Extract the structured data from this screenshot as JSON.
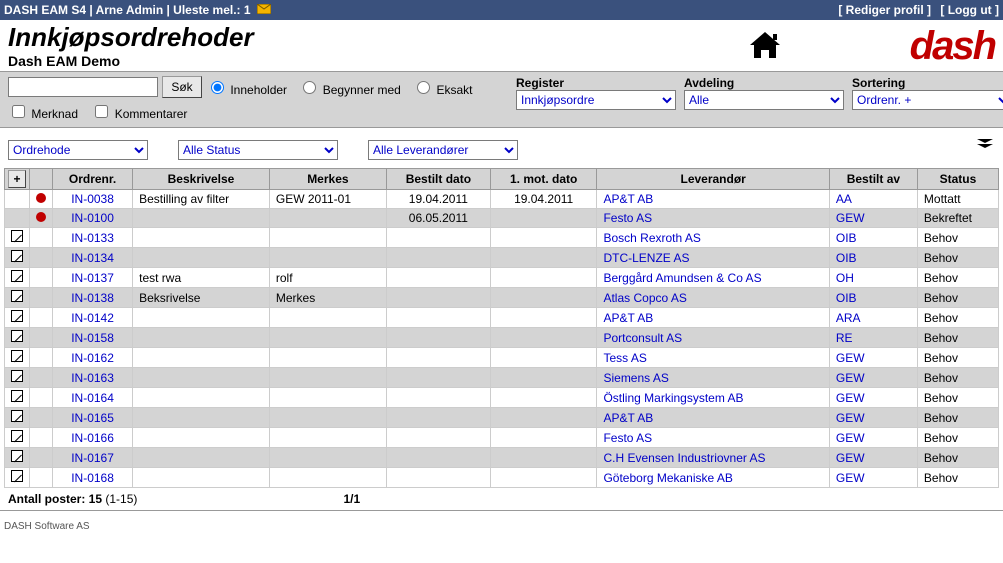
{
  "topbar": {
    "title": "DASH EAM S4 | Arne Admin | Uleste mel.: 1",
    "links": {
      "edit_profile": "[ Rediger profil ]",
      "logout": "[ Logg ut ]"
    }
  },
  "header": {
    "title": "Innkjøpsordrehoder",
    "subtitle": "Dash EAM Demo",
    "logo_text": "dash"
  },
  "search": {
    "search_btn": "Søk",
    "radio_inneholder": "Inneholder",
    "radio_begynner": "Begynner med",
    "radio_eksakt": "Eksakt",
    "chk_merknad": "Merknad",
    "chk_kommentarer": "Kommentarer",
    "register_label": "Register",
    "register_value": "Innkjøpsordre",
    "avdeling_label": "Avdeling",
    "avdeling_value": "Alle",
    "sortering_label": "Sortering",
    "sortering_value": "Ordrenr. +"
  },
  "filters": {
    "ordrehode": "Ordrehode",
    "status": "Alle Status",
    "leverandor": "Alle Leverandører"
  },
  "table": {
    "headers": {
      "ordrenr": "Ordrenr.",
      "beskrivelse": "Beskrivelse",
      "merkes": "Merkes",
      "bestilt_dato": "Bestilt dato",
      "mot_dato": "1. mot. dato",
      "leverandor": "Leverandør",
      "bestilt_av": "Bestilt av",
      "status": "Status"
    },
    "rows": [
      {
        "icon": "dot",
        "ordrenr": "IN-0038",
        "besk": "Bestilling av filter",
        "merkes": "GEW 2011-01",
        "bdato": "19.04.2011",
        "mdato": "19.04.2011",
        "lev": "AP&T AB",
        "av": "AA",
        "status": "Mottatt"
      },
      {
        "icon": "dot",
        "ordrenr": "IN-0100",
        "besk": "",
        "merkes": "",
        "bdato": "06.05.2011",
        "mdato": "",
        "lev": "Festo AS",
        "av": "GEW",
        "status": "Bekreftet"
      },
      {
        "icon": "pencil",
        "ordrenr": "IN-0133",
        "besk": "",
        "merkes": "",
        "bdato": "",
        "mdato": "",
        "lev": "Bosch Rexroth AS",
        "av": "OIB",
        "status": "Behov"
      },
      {
        "icon": "pencil",
        "ordrenr": "IN-0134",
        "besk": "",
        "merkes": "",
        "bdato": "",
        "mdato": "",
        "lev": "DTC-LENZE AS",
        "av": "OIB",
        "status": "Behov"
      },
      {
        "icon": "pencil",
        "ordrenr": "IN-0137",
        "besk": "test rwa",
        "merkes": "rolf",
        "bdato": "",
        "mdato": "",
        "lev": "Berggård Amundsen & Co AS",
        "av": "OH",
        "status": "Behov"
      },
      {
        "icon": "pencil",
        "ordrenr": "IN-0138",
        "besk": "Beksrivelse",
        "merkes": "Merkes",
        "bdato": "",
        "mdato": "",
        "lev": "Atlas Copco AS",
        "av": "OIB",
        "status": "Behov"
      },
      {
        "icon": "pencil",
        "ordrenr": "IN-0142",
        "besk": "",
        "merkes": "",
        "bdato": "",
        "mdato": "",
        "lev": "AP&T AB",
        "av": "ARA",
        "status": "Behov"
      },
      {
        "icon": "pencil",
        "ordrenr": "IN-0158",
        "besk": "",
        "merkes": "",
        "bdato": "",
        "mdato": "",
        "lev": "Portconsult AS",
        "av": "RE",
        "status": "Behov"
      },
      {
        "icon": "pencil",
        "ordrenr": "IN-0162",
        "besk": "",
        "merkes": "",
        "bdato": "",
        "mdato": "",
        "lev": "Tess AS",
        "av": "GEW",
        "status": "Behov"
      },
      {
        "icon": "pencil",
        "ordrenr": "IN-0163",
        "besk": "",
        "merkes": "",
        "bdato": "",
        "mdato": "",
        "lev": "Siemens AS",
        "av": "GEW",
        "status": "Behov"
      },
      {
        "icon": "pencil",
        "ordrenr": "IN-0164",
        "besk": "",
        "merkes": "",
        "bdato": "",
        "mdato": "",
        "lev": "Östling Markingsystem AB",
        "av": "GEW",
        "status": "Behov"
      },
      {
        "icon": "pencil",
        "ordrenr": "IN-0165",
        "besk": "",
        "merkes": "",
        "bdato": "",
        "mdato": "",
        "lev": "AP&T AB",
        "av": "GEW",
        "status": "Behov"
      },
      {
        "icon": "pencil",
        "ordrenr": "IN-0166",
        "besk": "",
        "merkes": "",
        "bdato": "",
        "mdato": "",
        "lev": "Festo AS",
        "av": "GEW",
        "status": "Behov"
      },
      {
        "icon": "pencil",
        "ordrenr": "IN-0167",
        "besk": "",
        "merkes": "",
        "bdato": "",
        "mdato": "",
        "lev": "C.H Evensen Industriovner AS",
        "av": "GEW",
        "status": "Behov"
      },
      {
        "icon": "pencil",
        "ordrenr": "IN-0168",
        "besk": "",
        "merkes": "",
        "bdato": "",
        "mdato": "",
        "lev": "Göteborg Mekaniske AB",
        "av": "GEW",
        "status": "Behov"
      }
    ]
  },
  "footer": {
    "count_label": "Antall poster: 15",
    "range": " (1-15)",
    "pages": "1/1",
    "company": "DASH Software AS"
  }
}
